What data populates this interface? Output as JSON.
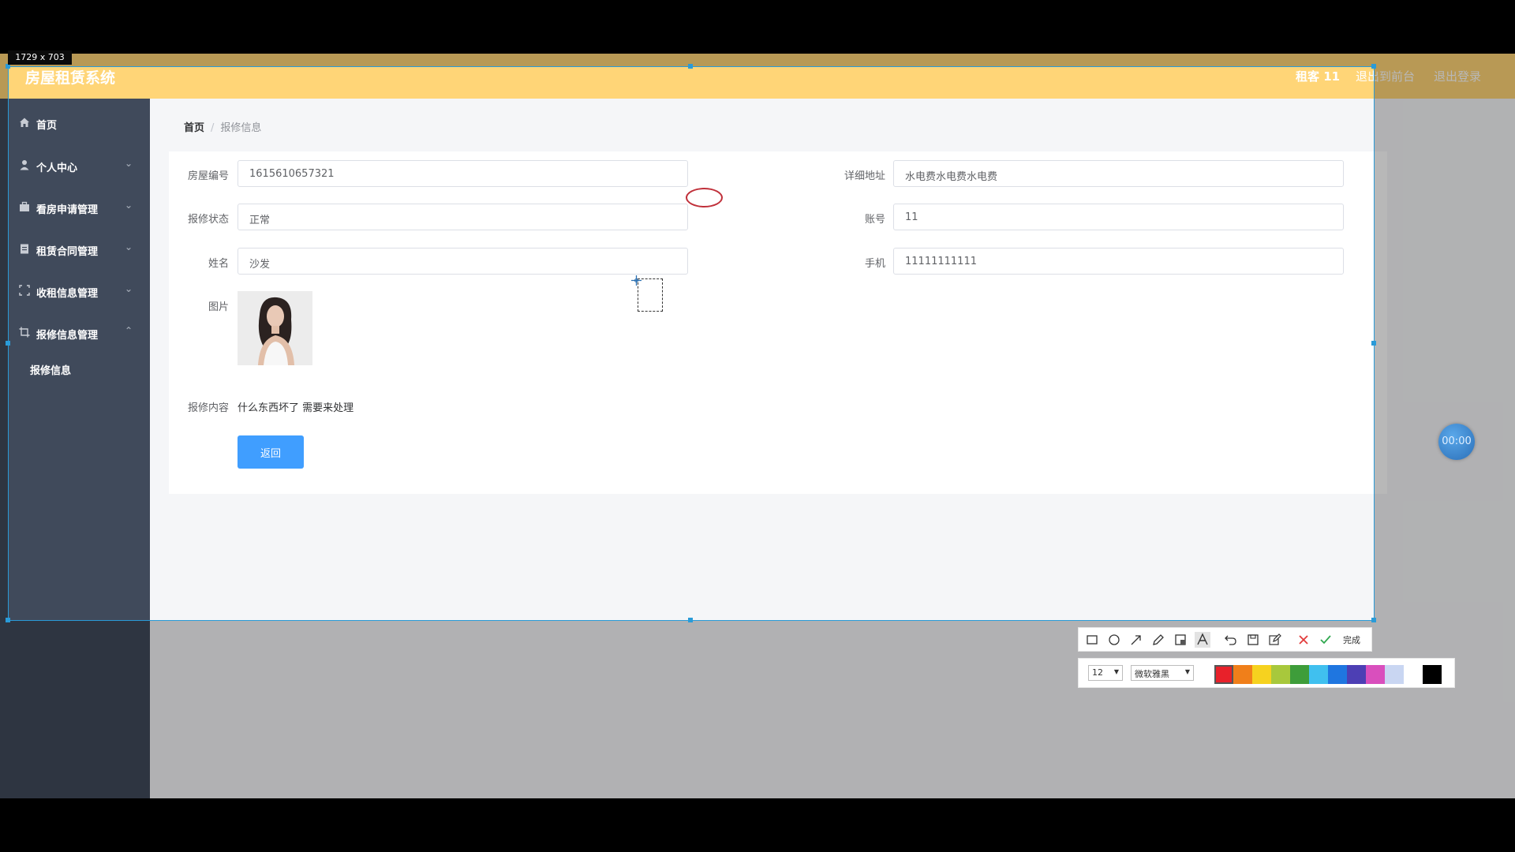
{
  "header": {
    "app_title": "房屋租赁系统",
    "user_label": "租客 11",
    "front_link": "退出到前台",
    "logout_link": "退出登录"
  },
  "sidebar": {
    "items": [
      {
        "label": "首页",
        "icon": "home-icon"
      },
      {
        "label": "个人中心",
        "icon": "user-icon"
      },
      {
        "label": "看房申请管理",
        "icon": "briefcase-icon"
      },
      {
        "label": "租赁合同管理",
        "icon": "clipboard-icon"
      },
      {
        "label": "收租信息管理",
        "icon": "fullscreen-icon"
      },
      {
        "label": "报修信息管理",
        "icon": "crop-icon"
      }
    ],
    "sub_item": "报修信息"
  },
  "breadcrumb": {
    "home": "首页",
    "separator": "/",
    "current": "报修信息"
  },
  "form": {
    "house_no_label": "房屋编号",
    "house_no_value": "1615610657321",
    "address_label": "详细地址",
    "address_value": "水电费水电费水电费",
    "status_label": "报修状态",
    "status_value": "正常",
    "account_label": "账号",
    "account_value": "11",
    "name_label": "姓名",
    "name_value": "沙发",
    "phone_label": "手机",
    "phone_value": "11111111111",
    "picture_label": "图片",
    "content_label": "报修内容",
    "content_value": "什么东西坏了 需要来处理",
    "back_button": "返回"
  },
  "timer": "00:00",
  "capture": {
    "selection_size": "1729 x 703",
    "done_label": "完成",
    "font_size": "12",
    "font_name": "微软雅黑",
    "colors": [
      "#e8212a",
      "#f07f1a",
      "#f6d21f",
      "#a8c83c",
      "#3e9d3a",
      "#40c0ef",
      "#1f76e0",
      "#4d3fb4",
      "#d94fbd",
      "#c9d6f2",
      "#ffffff",
      "#000000"
    ]
  }
}
